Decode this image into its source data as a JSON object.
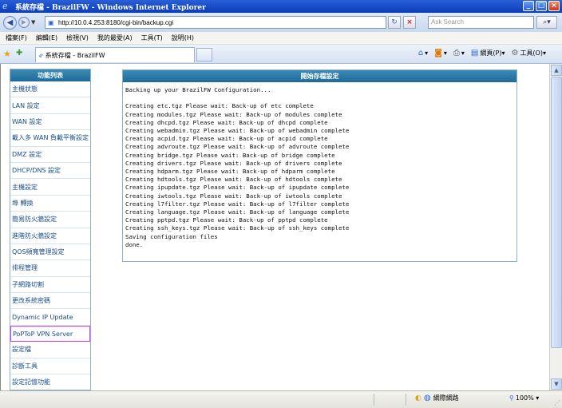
{
  "window": {
    "title": "系統存檔 - BrazilFW - Windows Internet Explorer"
  },
  "address": {
    "url": "http://10.0.4.253:8180/cgi-bin/backup.cgi",
    "search_placeholder": "Ask Search"
  },
  "menu": [
    "檔案(F)",
    "編輯(E)",
    "檢視(V)",
    "我的最愛(A)",
    "工具(T)",
    "說明(H)"
  ],
  "tab": {
    "title": "系統存檔 - BrazilFW"
  },
  "toolbar": {
    "page_label": "網頁(P)",
    "tools_label": "工具(O)"
  },
  "sidebar": {
    "header": "功能列表",
    "items": [
      "主機狀態",
      "LAN 設定",
      "WAN 設定",
      "載入多 WAN 負載平衡設定",
      "DMZ 設定",
      "DHCP/DNS 設定",
      "主機設定",
      "埠 轉換",
      "簡易防火牆設定",
      "進階防火牆設定",
      "QOS頻寬管理設定",
      "排程管理",
      "子網路切割",
      "更改系統密碼",
      "Dynamic IP Update",
      "PoPToP VPN Server",
      "設定檔",
      "診斷工具",
      "設定記憶功能"
    ],
    "highlighted_index": 15
  },
  "panel": {
    "header": "開始存檔設定",
    "log_lines": [
      "Backing up your BrazilFW Configuration...",
      "",
      "Creating etc.tgz Please wait: Back-up of etc complete",
      "Creating modules.tgz Please wait: Back-up of modules complete",
      "Creating dhcpd.tgz Please wait: Back-up of dhcpd complete",
      "Creating webadmin.tgz Please wait: Back-up of webadmin complete",
      "Creating acpid.tgz Please wait: Back-up of acpid complete",
      "Creating advroute.tgz Please wait: Back-up of advroute complete",
      "Creating bridge.tgz Please wait: Back-up of bridge complete",
      "Creating drivers.tgz Please wait: Back-up of drivers complete",
      "Creating hdparm.tgz Please wait: Back-up of hdparm complete",
      "Creating hdtools.tgz Please wait: Back-up of hdtools complete",
      "Creating ipupdate.tgz Please wait: Back-up of ipupdate complete",
      "Creating iwtools.tgz Please wait: Back-up of iwtools complete",
      "Creating l7filter.tgz Please wait: Back-up of l7filter complete",
      "Creating language.tgz Please wait: Back-up of language complete",
      "Creating pptpd.tgz Please wait: Back-up of pptpd complete",
      "Creating ssh_keys.tgz Please wait: Back-up of ssh_keys complete",
      "Saving configuration files",
      "done."
    ]
  },
  "status": {
    "zone": "網際網路",
    "zoom": "100%"
  },
  "icons": [
    "ie-icon",
    "back-arrow-icon",
    "forward-arrow-icon",
    "refresh-icon",
    "stop-icon",
    "search-icon",
    "star-icon",
    "add-favorite-icon",
    "home-icon",
    "rss-icon",
    "print-icon",
    "page-icon",
    "tools-gear-icon",
    "globe-icon",
    "zoom-icon"
  ]
}
